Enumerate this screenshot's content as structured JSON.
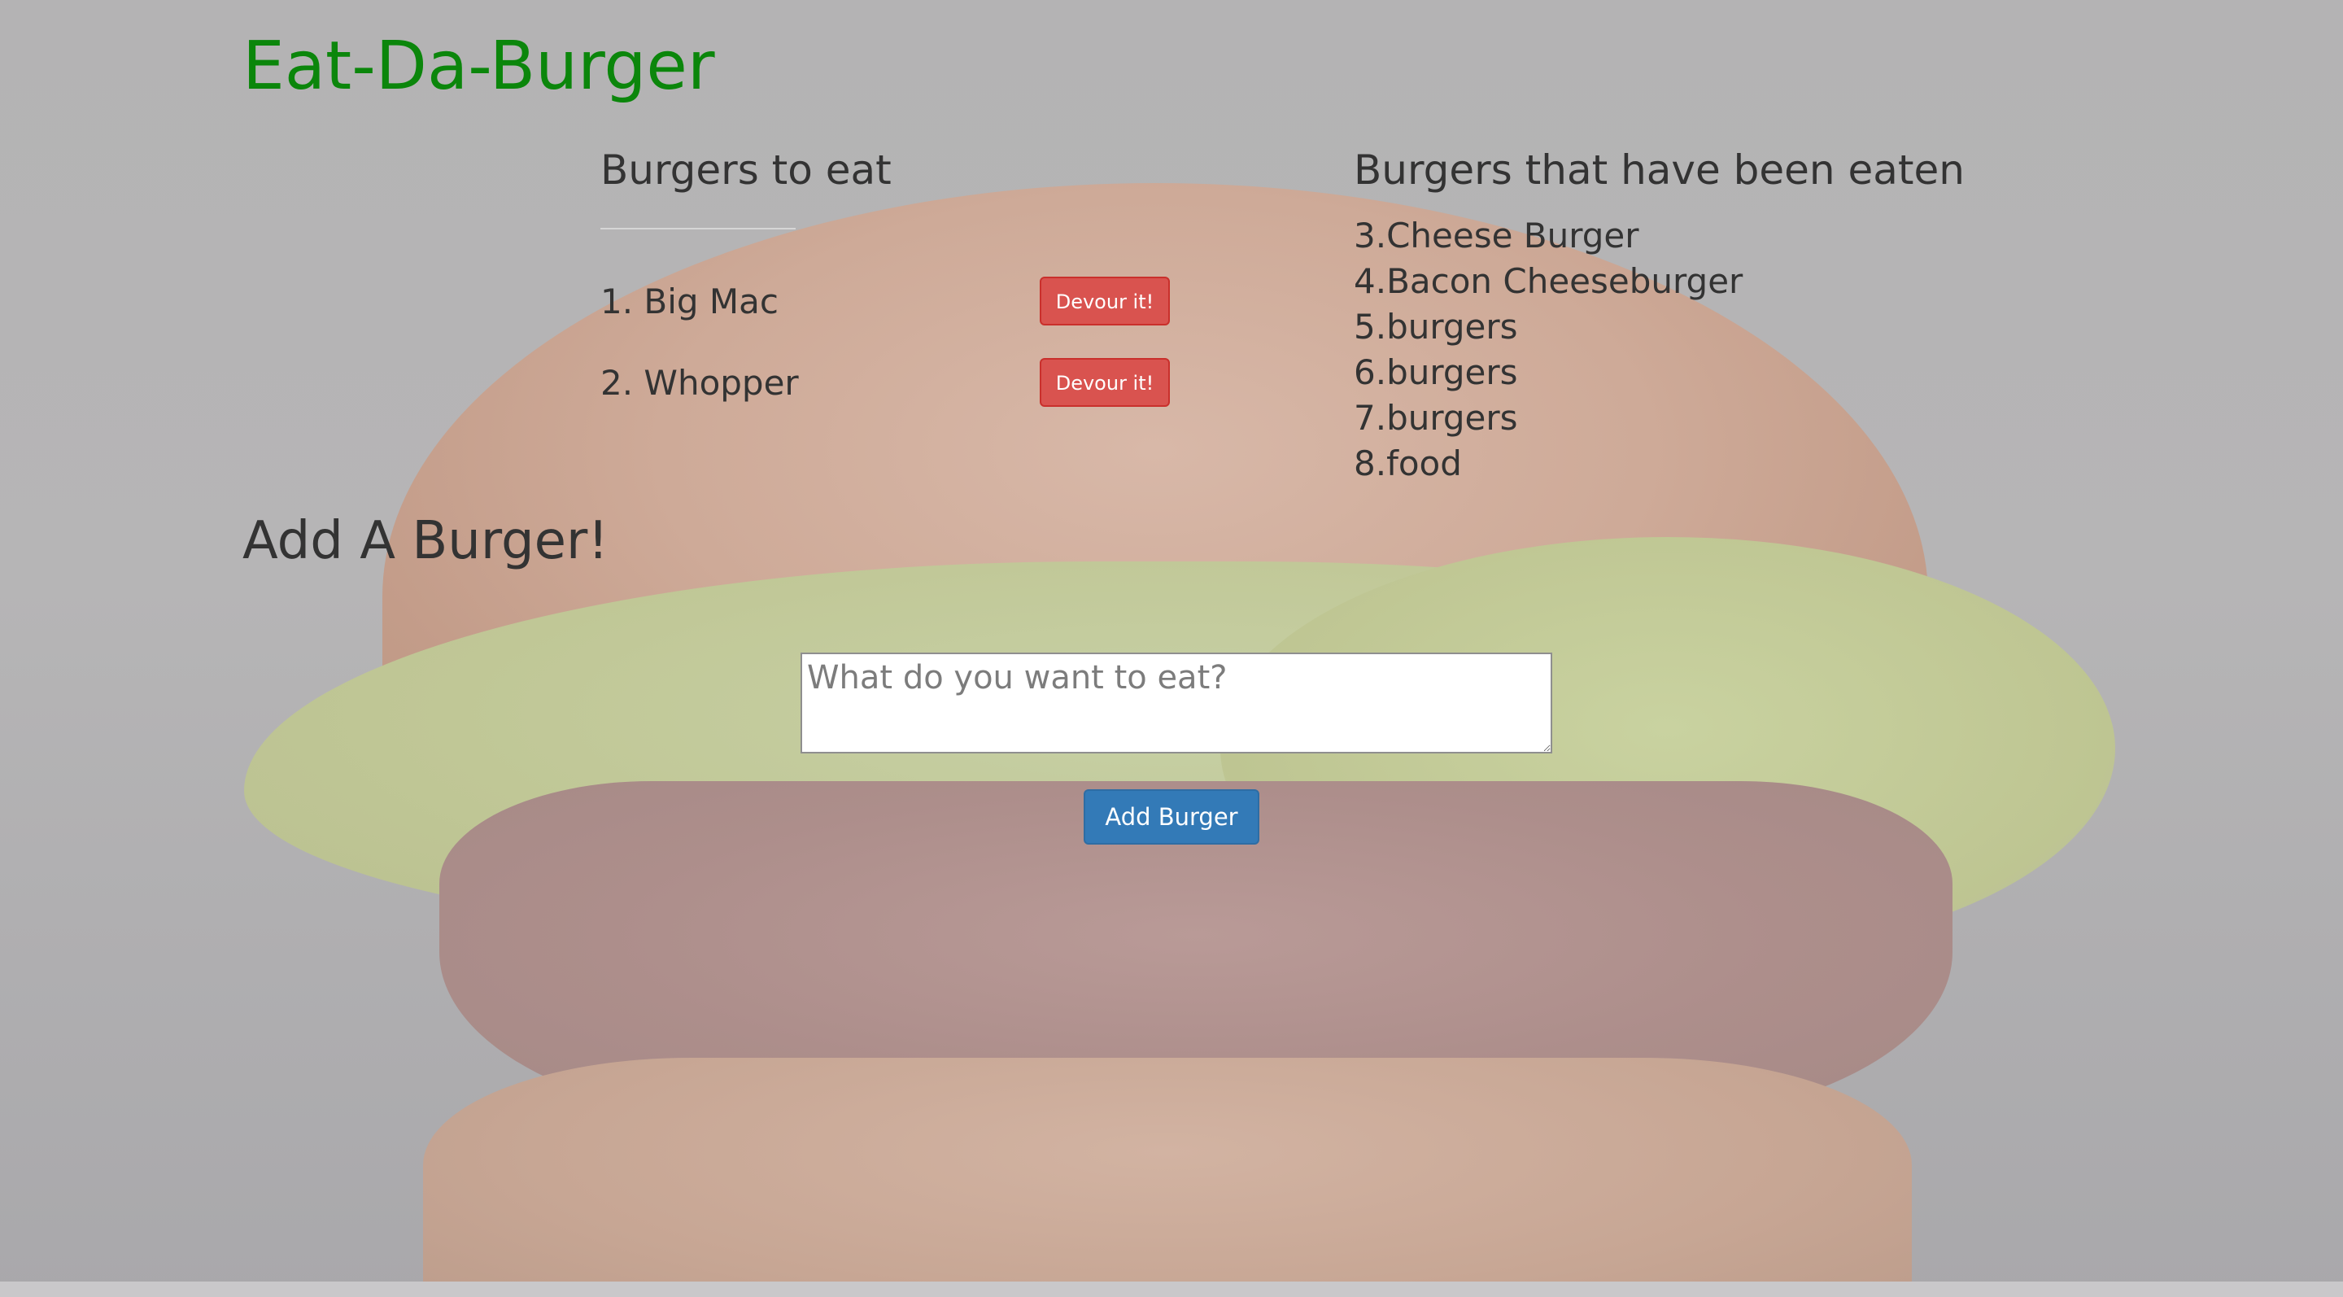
{
  "app": {
    "title": "Eat-Da-Burger"
  },
  "to_eat": {
    "heading": "Burgers to eat",
    "items": [
      {
        "label": "1. Big Mac",
        "button": "Devour it!"
      },
      {
        "label": "2. Whopper",
        "button": "Devour it!"
      }
    ]
  },
  "eaten": {
    "heading": "Burgers that have been eaten",
    "items": [
      "3.Cheese Burger",
      "4.Bacon Cheeseburger",
      "5.burgers",
      "6.burgers",
      "7.burgers",
      "8.food"
    ]
  },
  "add_form": {
    "heading": "Add A Burger!",
    "placeholder": "What do you want to eat?",
    "value": "",
    "submit_label": "Add Burger"
  },
  "colors": {
    "title": "#0b860b",
    "devour_button": "#d9534f",
    "add_button": "#337ab7",
    "text": "#333333"
  },
  "background": {
    "icon": "burger-photo"
  }
}
